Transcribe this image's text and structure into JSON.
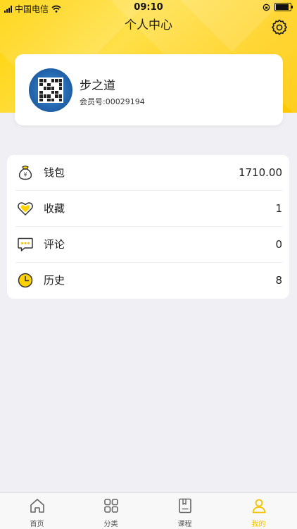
{
  "status_bar": {
    "carrier": "中国电信",
    "time": "09:10"
  },
  "header": {
    "title": "个人中心"
  },
  "profile": {
    "name": "步之道",
    "member_id": "会员号:00029194"
  },
  "menu": [
    {
      "icon": "wallet-icon",
      "label": "钱包",
      "value": "1710.00"
    },
    {
      "icon": "heart-icon",
      "label": "收藏",
      "value": "1"
    },
    {
      "icon": "comment-icon",
      "label": "评论",
      "value": "0"
    },
    {
      "icon": "clock-icon",
      "label": "历史",
      "value": "8"
    }
  ],
  "tabbar": [
    {
      "icon": "home-icon",
      "label": "首页",
      "active": false
    },
    {
      "icon": "grid-icon",
      "label": "分类",
      "active": false
    },
    {
      "icon": "book-icon",
      "label": "课程",
      "active": false
    },
    {
      "icon": "user-icon",
      "label": "我的",
      "active": true
    }
  ],
  "colors": {
    "accent": "#ffd200",
    "active_tab": "#f2c300"
  }
}
